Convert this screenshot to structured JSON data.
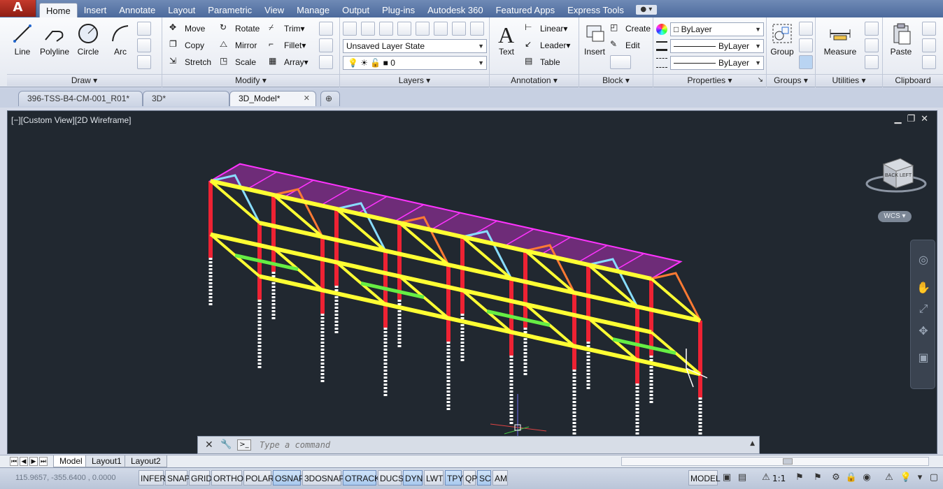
{
  "ribbon": {
    "tabs": [
      "Home",
      "Insert",
      "Annotate",
      "Layout",
      "Parametric",
      "View",
      "Manage",
      "Output",
      "Plug-ins",
      "Autodesk 360",
      "Featured Apps",
      "Express Tools"
    ],
    "active_tab": "Home"
  },
  "draw": {
    "title": "Draw",
    "line": "Line",
    "polyline": "Polyline",
    "circle": "Circle",
    "arc": "Arc"
  },
  "modify": {
    "title": "Modify",
    "move": "Move",
    "rotate": "Rotate",
    "trim": "Trim",
    "copy": "Copy",
    "mirror": "Mirror",
    "fillet": "Fillet",
    "stretch": "Stretch",
    "scale": "Scale",
    "array": "Array"
  },
  "layers": {
    "title": "Layers",
    "layer_state": "Unsaved Layer State",
    "current_layer": "0"
  },
  "annotation": {
    "title": "Annotation",
    "text": "Text",
    "linear": "Linear",
    "leader": "Leader",
    "table": "Table"
  },
  "block": {
    "title": "Block",
    "insert": "Insert",
    "create": "Create",
    "edit": "Edit"
  },
  "properties": {
    "title": "Properties",
    "color": "ByLayer",
    "linetype": "ByLayer",
    "lineweight": "ByLayer"
  },
  "groups": {
    "title": "Groups",
    "group": "Group"
  },
  "utilities": {
    "title": "Utilities",
    "measure": "Measure"
  },
  "clipboard": {
    "title": "Clipboard",
    "paste": "Paste"
  },
  "doc_tabs": [
    {
      "label": "396-TSS-B4-CM-001_R01*"
    },
    {
      "label": "3D*"
    },
    {
      "label": "3D_Model*"
    }
  ],
  "viewport": {
    "label": "[−][Custom View][2D Wireframe]",
    "viewcube_back": "BACK",
    "viewcube_left": "LEFT",
    "wcs": "WCS",
    "axis_z": "Z",
    "axis_y": "Y",
    "axis_x": "X"
  },
  "command": {
    "placeholder": "Type a command"
  },
  "layout_tabs": [
    "Model",
    "Layout1",
    "Layout2"
  ],
  "status": {
    "coords": "115.9657, -355.6400 , 0.0000",
    "toggles": [
      {
        "label": "INFER",
        "on": false
      },
      {
        "label": "SNAP",
        "on": false
      },
      {
        "label": "GRID",
        "on": false
      },
      {
        "label": "ORTHO",
        "on": false
      },
      {
        "label": "POLAR",
        "on": false
      },
      {
        "label": "OSNAP",
        "on": true
      },
      {
        "label": "3DOSNAP",
        "on": false
      },
      {
        "label": "OTRACK",
        "on": true
      },
      {
        "label": "DUCS",
        "on": false
      },
      {
        "label": "DYN",
        "on": true
      },
      {
        "label": "LWT",
        "on": false
      },
      {
        "label": "TPY",
        "on": true
      },
      {
        "label": "QP",
        "on": false
      },
      {
        "label": "SC",
        "on": true
      },
      {
        "label": "AM",
        "on": false
      }
    ],
    "space": "MODEL",
    "scale": "1:1"
  },
  "colors": {
    "roof": "#ff33ff",
    "truss": "#ff7a33",
    "beam": "#ffff33",
    "column": "#ee2233",
    "brace": "#66ee44",
    "pile": "#ffffff",
    "bracing_light": "#88ddff"
  }
}
